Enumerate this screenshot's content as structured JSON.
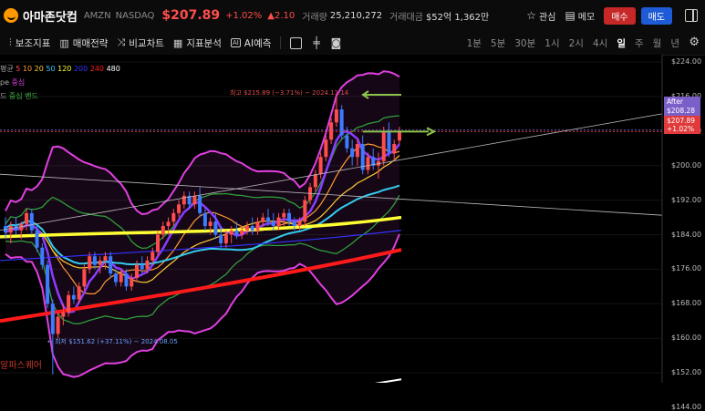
{
  "header": {
    "name": "아마존닷컴",
    "ticker": "AMZN",
    "exchange": "NASDAQ",
    "price": "$207.89",
    "change_pct": "+1.02%",
    "change": "▲2.10",
    "volume_label": "거래량",
    "volume": "25,210,272",
    "amount_label": "거래대금",
    "amount": "$52억 1,362만",
    "watch_label": "관심",
    "memo_label": "메모",
    "buy_label": "매수",
    "sell_label": "매도"
  },
  "toolbar": {
    "items": [
      "보조지표",
      "매매전략",
      "비교차트",
      "지표분석",
      "AI예측"
    ],
    "periods": [
      "1분",
      "5분",
      "30분",
      "1시",
      "2시",
      "4시",
      "일",
      "주",
      "월",
      "년"
    ],
    "active_period": "일"
  },
  "legend": {
    "ma_title": "평균",
    "ma_periods": [
      "5",
      "10",
      "20",
      "50",
      "120",
      "200",
      "240",
      "480"
    ],
    "ma_colors": [
      "#ff4d4d",
      "#ff9933",
      "#ffcc33",
      "#33ccff",
      "#ffff33",
      "#3333ff",
      "#ff1a1a",
      "#ffffff"
    ],
    "line2_a": "pe",
    "line2_b": "중심",
    "line3_a": "드",
    "line3_b": "중심 밴드"
  },
  "axis": {
    "labels": [
      "$224.00",
      "$216.00",
      "$208.00",
      "$200.00",
      "$192.00",
      "$184.00",
      "$176.00",
      "$168.00",
      "$160.00",
      "$152.00",
      "$144.00"
    ]
  },
  "after_box": {
    "label": "After",
    "value": "$208.28"
  },
  "price_box": {
    "value": "$207.89",
    "pct": "+1.02%"
  },
  "annotations": {
    "high": "최고 $215.89 (−3.71%) − 2024.11.14",
    "low": "최저 $151.62 (+37.11%) − 2024.08.05"
  },
  "brand": "알파스퀘어",
  "colors": {
    "up": "#ff4d4d",
    "down": "#3d7bff",
    "accent_after": "#7b5fc9"
  },
  "chart_data": {
    "type": "candlestick",
    "ylim": [
      144,
      226
    ],
    "candles": [
      {
        "o": 186,
        "h": 188,
        "l": 183,
        "c": 184.5
      },
      {
        "o": 184.5,
        "h": 187,
        "l": 182,
        "c": 186
      },
      {
        "o": 186,
        "h": 188,
        "l": 184,
        "c": 185
      },
      {
        "o": 185,
        "h": 187,
        "l": 183,
        "c": 186.5
      },
      {
        "o": 186.5,
        "h": 190,
        "l": 185,
        "c": 189
      },
      {
        "o": 189,
        "h": 190,
        "l": 184,
        "c": 185
      },
      {
        "o": 185,
        "h": 186,
        "l": 180,
        "c": 181
      },
      {
        "o": 181,
        "h": 182,
        "l": 176,
        "c": 177
      },
      {
        "o": 177,
        "h": 178,
        "l": 167,
        "c": 168
      },
      {
        "o": 168,
        "h": 169,
        "l": 151.6,
        "c": 161
      },
      {
        "o": 161,
        "h": 166,
        "l": 160,
        "c": 165
      },
      {
        "o": 165,
        "h": 168,
        "l": 163,
        "c": 166
      },
      {
        "o": 166,
        "h": 171,
        "l": 165,
        "c": 170
      },
      {
        "o": 170,
        "h": 172,
        "l": 168,
        "c": 169
      },
      {
        "o": 169,
        "h": 173,
        "l": 168,
        "c": 172
      },
      {
        "o": 172,
        "h": 177,
        "l": 171,
        "c": 176
      },
      {
        "o": 176,
        "h": 180,
        "l": 175,
        "c": 179
      },
      {
        "o": 179,
        "h": 180,
        "l": 176,
        "c": 177
      },
      {
        "o": 177,
        "h": 179,
        "l": 175,
        "c": 178
      },
      {
        "o": 178,
        "h": 180,
        "l": 176,
        "c": 179
      },
      {
        "o": 179,
        "h": 180,
        "l": 174,
        "c": 175
      },
      {
        "o": 175,
        "h": 176,
        "l": 172,
        "c": 173
      },
      {
        "o": 173,
        "h": 176,
        "l": 172,
        "c": 175
      },
      {
        "o": 175,
        "h": 176,
        "l": 171,
        "c": 172
      },
      {
        "o": 172,
        "h": 175,
        "l": 171,
        "c": 174
      },
      {
        "o": 174,
        "h": 178,
        "l": 173,
        "c": 177
      },
      {
        "o": 177,
        "h": 179,
        "l": 175,
        "c": 176
      },
      {
        "o": 176,
        "h": 179,
        "l": 175,
        "c": 178
      },
      {
        "o": 178,
        "h": 181,
        "l": 177,
        "c": 180
      },
      {
        "o": 180,
        "h": 185,
        "l": 179,
        "c": 184
      },
      {
        "o": 184,
        "h": 187,
        "l": 183,
        "c": 186
      },
      {
        "o": 186,
        "h": 188,
        "l": 184,
        "c": 187
      },
      {
        "o": 187,
        "h": 190,
        "l": 186,
        "c": 189
      },
      {
        "o": 189,
        "h": 192,
        "l": 188,
        "c": 191
      },
      {
        "o": 191,
        "h": 194,
        "l": 190,
        "c": 193
      },
      {
        "o": 193,
        "h": 194,
        "l": 190,
        "c": 191
      },
      {
        "o": 191,
        "h": 194,
        "l": 190,
        "c": 193
      },
      {
        "o": 193,
        "h": 195,
        "l": 188,
        "c": 189
      },
      {
        "o": 189,
        "h": 190,
        "l": 185,
        "c": 186
      },
      {
        "o": 186,
        "h": 188,
        "l": 184,
        "c": 187
      },
      {
        "o": 187,
        "h": 189,
        "l": 183,
        "c": 184
      },
      {
        "o": 184,
        "h": 186,
        "l": 181,
        "c": 182
      },
      {
        "o": 182,
        "h": 185,
        "l": 181,
        "c": 184
      },
      {
        "o": 184,
        "h": 186,
        "l": 182,
        "c": 185
      },
      {
        "o": 185,
        "h": 187,
        "l": 183,
        "c": 184
      },
      {
        "o": 184,
        "h": 186,
        "l": 183,
        "c": 185
      },
      {
        "o": 185,
        "h": 187,
        "l": 184,
        "c": 186
      },
      {
        "o": 186,
        "h": 188,
        "l": 184,
        "c": 185
      },
      {
        "o": 185,
        "h": 188,
        "l": 184,
        "c": 187
      },
      {
        "o": 187,
        "h": 189,
        "l": 186,
        "c": 188
      },
      {
        "o": 188,
        "h": 190,
        "l": 186,
        "c": 187
      },
      {
        "o": 187,
        "h": 189,
        "l": 185,
        "c": 186
      },
      {
        "o": 186,
        "h": 189,
        "l": 185,
        "c": 188
      },
      {
        "o": 188,
        "h": 190,
        "l": 186,
        "c": 189
      },
      {
        "o": 189,
        "h": 190,
        "l": 186,
        "c": 187
      },
      {
        "o": 187,
        "h": 188,
        "l": 185,
        "c": 186
      },
      {
        "o": 186,
        "h": 188,
        "l": 185,
        "c": 187
      },
      {
        "o": 187,
        "h": 193,
        "l": 186,
        "c": 192
      },
      {
        "o": 192,
        "h": 196,
        "l": 191,
        "c": 195
      },
      {
        "o": 195,
        "h": 199,
        "l": 194,
        "c": 198
      },
      {
        "o": 198,
        "h": 203,
        "l": 197,
        "c": 202
      },
      {
        "o": 202,
        "h": 207,
        "l": 201,
        "c": 206
      },
      {
        "o": 206,
        "h": 211,
        "l": 205,
        "c": 210
      },
      {
        "o": 210,
        "h": 215.9,
        "l": 209,
        "c": 213
      },
      {
        "o": 213,
        "h": 214,
        "l": 206,
        "c": 207
      },
      {
        "o": 207,
        "h": 209,
        "l": 203,
        "c": 204
      },
      {
        "o": 204,
        "h": 206,
        "l": 200,
        "c": 202
      },
      {
        "o": 202,
        "h": 206,
        "l": 200,
        "c": 205
      },
      {
        "o": 205,
        "h": 207,
        "l": 198,
        "c": 199
      },
      {
        "o": 199,
        "h": 203,
        "l": 198,
        "c": 202
      },
      {
        "o": 202,
        "h": 204,
        "l": 199,
        "c": 200
      },
      {
        "o": 200,
        "h": 203,
        "l": 197,
        "c": 201
      },
      {
        "o": 201,
        "h": 209,
        "l": 200,
        "c": 208
      },
      {
        "o": 208,
        "h": 210,
        "l": 202,
        "c": 203
      },
      {
        "o": 203,
        "h": 206,
        "l": 201,
        "c": 205
      },
      {
        "o": 205.8,
        "h": 209,
        "l": 205,
        "c": 207.89
      }
    ]
  }
}
